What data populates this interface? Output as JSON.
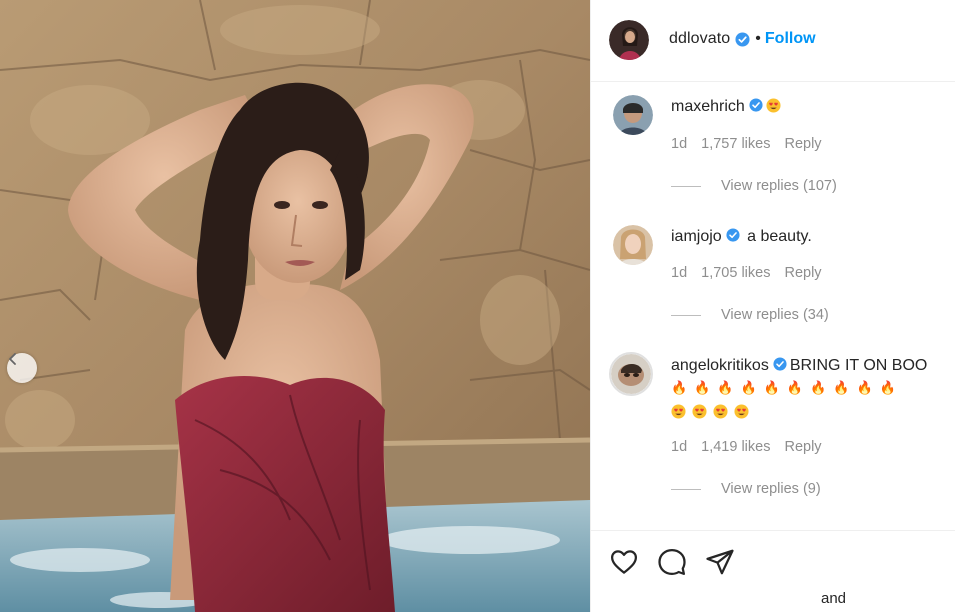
{
  "post": {
    "author": "ddlovato",
    "separator": "•",
    "follow_label": "Follow"
  },
  "comments": [
    {
      "username": "maxehrich",
      "text": "",
      "emoji": "heart-eyes",
      "time": "1d",
      "likes": "1,757 likes",
      "reply_label": "Reply",
      "view_replies": "View replies (107)"
    },
    {
      "username": "iamjojo",
      "text": "a beauty.",
      "time": "1d",
      "likes": "1,705 likes",
      "reply_label": "Reply",
      "view_replies": "View replies (34)"
    },
    {
      "username": "angelokritikos",
      "text": "BRING IT ON BOO",
      "emoji_line": "🔥🔥🔥🔥🔥🔥🔥🔥🔥🔥",
      "heart_eyes_count": 4,
      "time": "1d",
      "likes": "1,419 likes",
      "reply_label": "Reply",
      "view_replies": "View replies (9)"
    }
  ],
  "footer": {
    "truncated_text": "and"
  },
  "icons": {
    "like": "heart-icon",
    "comment": "comment-icon",
    "share": "paper-plane-icon",
    "verified": "verified-badge-icon",
    "carousel_prev": "chevron-left-icon"
  },
  "colors": {
    "link_blue": "#0095f6",
    "secondary_text": "#8e8e8e",
    "verified_blue": "#3897f0"
  }
}
